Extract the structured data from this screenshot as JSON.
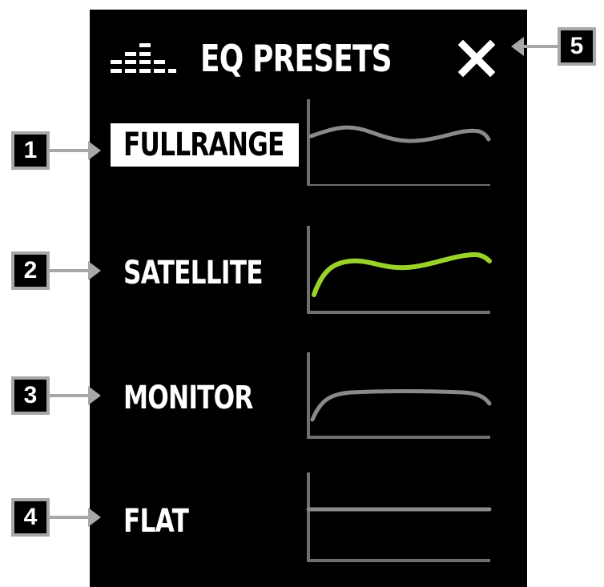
{
  "header": {
    "title": "EQ PRESETS",
    "icon": "equalizer-bars-icon",
    "close_icon": "close-x-icon"
  },
  "presets": [
    {
      "label": "FULLRANGE",
      "selected": true,
      "curve_color": "#8a8a8a",
      "callout": "1"
    },
    {
      "label": "SATELLITE",
      "selected": false,
      "curve_color": "#9ad22a",
      "callout": "2"
    },
    {
      "label": "MONITOR",
      "selected": false,
      "curve_color": "#8a8a8a",
      "callout": "3"
    },
    {
      "label": "FLAT",
      "selected": false,
      "curve_color": "#8a8a8a",
      "callout": "4"
    }
  ],
  "close_callout": "5",
  "colors": {
    "background": "#000000",
    "text": "#ffffff",
    "accent_curve": "#9ad22a",
    "neutral_curve": "#8a8a8a",
    "axis": "#6f6f6f",
    "callout_border": "#a8a8a8"
  }
}
